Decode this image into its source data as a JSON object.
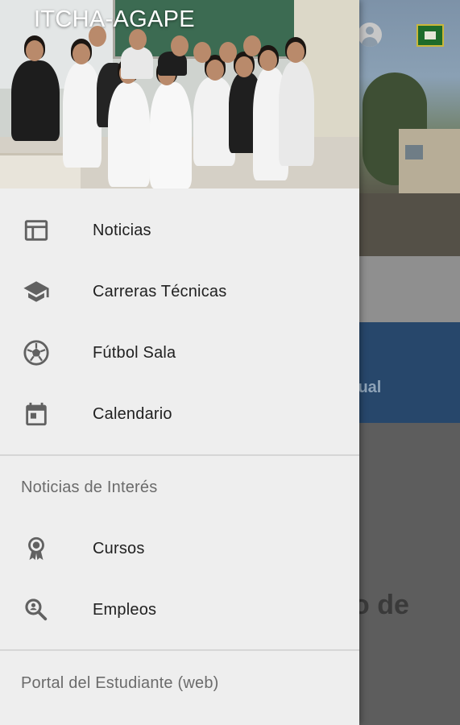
{
  "drawer": {
    "title": "ITCHA-AGAPE",
    "items": [
      {
        "label": "Noticias",
        "icon": "news-icon"
      },
      {
        "label": "Carreras Técnicas",
        "icon": "school-icon"
      },
      {
        "label": "Fútbol Sala",
        "icon": "soccer-ball-icon"
      },
      {
        "label": "Calendario",
        "icon": "calendar-icon"
      }
    ],
    "section_title": "Noticias de Interés",
    "section_items": [
      {
        "label": "Cursos",
        "icon": "award-icon"
      },
      {
        "label": "Empleos",
        "icon": "search-person-icon"
      }
    ],
    "portal_label": "Portal del Estudiante (web)"
  },
  "background": {
    "blue_banner_text": "rtual",
    "content_text": "o de"
  },
  "colors": {
    "drawer_bg": "#eeeeee",
    "text_primary": "#212121",
    "text_secondary": "#6b6b6b",
    "icon": "#616161",
    "banner_blue": "#27476b"
  }
}
